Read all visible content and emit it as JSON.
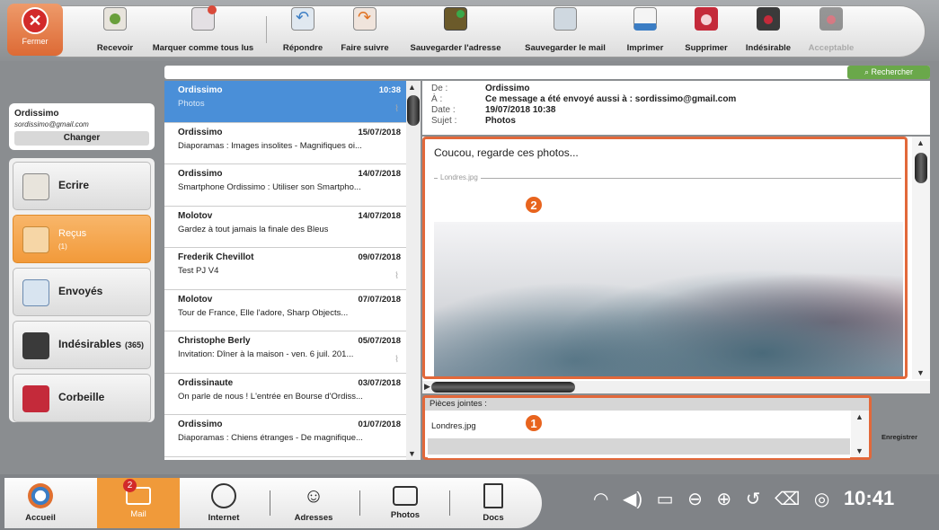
{
  "toolbar": {
    "close_label": "Fermer",
    "buttons": [
      {
        "label": "Recevoir"
      },
      {
        "label": "Marquer comme tous lus"
      },
      {
        "label": "Répondre"
      },
      {
        "label": "Faire suivre"
      },
      {
        "label": "Sauvegarder l'adresse"
      },
      {
        "label": "Sauvegarder le mail"
      },
      {
        "label": "Imprimer"
      },
      {
        "label": "Supprimer"
      },
      {
        "label": "Indésirable"
      },
      {
        "label": "Acceptable"
      }
    ]
  },
  "account": {
    "name": "Ordissimo",
    "email": "sordissimo@gmail.com",
    "change_label": "Changer"
  },
  "folders": [
    {
      "label": "Ecrire"
    },
    {
      "label": "Reçus",
      "count": "(1)"
    },
    {
      "label": "Envoyés"
    },
    {
      "label": "Indésirables",
      "badge": "(365)"
    },
    {
      "label": "Corbeille"
    }
  ],
  "search": {
    "label": "Rechercher"
  },
  "messages": [
    {
      "from": "Ordissimo",
      "date": "10:38",
      "preview": "Photos"
    },
    {
      "from": "Ordissimo",
      "date": "15/07/2018",
      "preview": "Diaporamas : Images insolites - Magnifiques oi..."
    },
    {
      "from": "Ordissimo",
      "date": "14/07/2018",
      "preview": "Smartphone Ordissimo : Utiliser son Smartpho..."
    },
    {
      "from": "Molotov",
      "date": "14/07/2018",
      "preview": "Gardez à tout jamais la finale des Bleus"
    },
    {
      "from": "Frederik Chevillot",
      "date": "09/07/2018",
      "preview": "Test PJ V4"
    },
    {
      "from": "Molotov",
      "date": "07/07/2018",
      "preview": "Tour de France, Elle l'adore, Sharp Objects..."
    },
    {
      "from": "Christophe Berly",
      "date": "05/07/2018",
      "preview": "Invitation: Dîner à la maison - ven. 6 juil. 201..."
    },
    {
      "from": "Ordissinaute",
      "date": "03/07/2018",
      "preview": "On parle de nous ! L'entrée en Bourse d'Ordiss..."
    },
    {
      "from": "Ordissimo",
      "date": "01/07/2018",
      "preview": "Diaporamas : Chiens étranges - De magnifique..."
    }
  ],
  "header": {
    "from_label": "De :",
    "from_value": "Ordissimo",
    "to_label": "À :",
    "to_value": "Ce message a été envoyé aussi à : sordissimo@gmail.com",
    "date_label": "Date :",
    "date_value": "19/07/2018 10:38",
    "subject_label": "Sujet :",
    "subject_value": "Photos"
  },
  "body": {
    "greeting": "Coucou, regarde ces photos...",
    "image_name": "Londres.jpg"
  },
  "attachments": {
    "title": "Pièces jointes :",
    "items": [
      "Londres.jpg"
    ],
    "save_label": "Enregistrer"
  },
  "callouts": {
    "body": "2",
    "attachments": "1"
  },
  "taskbar": {
    "items": [
      {
        "label": "Accueil"
      },
      {
        "label": "Mail",
        "badge": "2"
      },
      {
        "label": "Internet"
      },
      {
        "label": "Adresses"
      },
      {
        "label": "Photos"
      },
      {
        "label": "Docs"
      }
    ],
    "clock": "10:41"
  },
  "colors": {
    "accent": "#f09a3a",
    "selection": "#4a8fd8",
    "callout": "#e8641e",
    "search": "#6aa84a"
  }
}
